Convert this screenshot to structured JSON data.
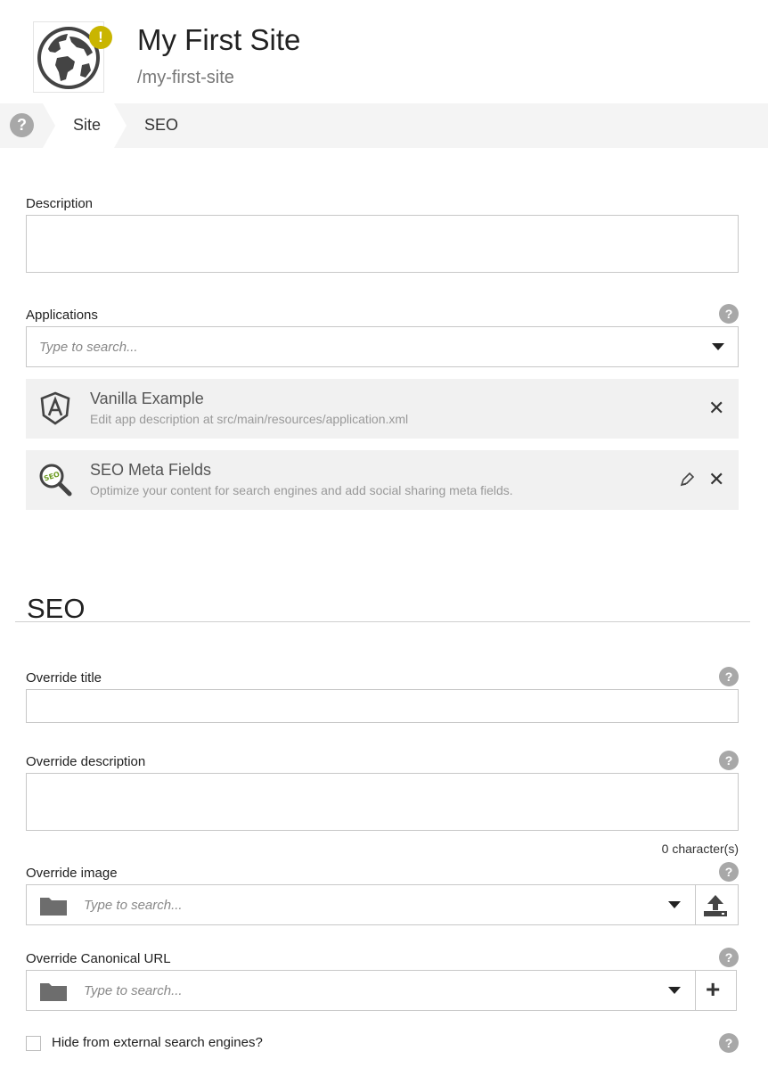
{
  "header": {
    "title": "My First Site",
    "path": "/my-first-site",
    "warning_badge": "!",
    "icon": "globe-icon"
  },
  "tabs": {
    "help": "?",
    "items": [
      {
        "label": "Site",
        "active": true
      },
      {
        "label": "SEO",
        "active": false
      }
    ]
  },
  "site_form": {
    "description_label": "Description",
    "description_value": "",
    "applications_label": "Applications",
    "applications_placeholder": "Type to search...",
    "applications": [
      {
        "name": "Vanilla Example",
        "description": "Edit app description at src/main/resources/application.xml",
        "icon": "app-shield-icon",
        "editable": false
      },
      {
        "name": "SEO Meta Fields",
        "description": "Optimize your content for search engines and add social sharing meta fields.",
        "icon": "seo-magnifier-icon",
        "editable": true
      }
    ]
  },
  "seo_form": {
    "section_title": "SEO",
    "override_title_label": "Override title",
    "override_title_value": "",
    "override_description_label": "Override description",
    "override_description_value": "",
    "character_count": "0 character(s)",
    "override_image_label": "Override image",
    "override_image_placeholder": "Type to search...",
    "override_canonical_label": "Override Canonical URL",
    "override_canonical_placeholder": "Type to search...",
    "add_symbol": "+",
    "hide_label": "Hide from external search engines?",
    "hide_checked": false,
    "help": "?"
  },
  "colors": {
    "warning": "#c9b500",
    "tabbar": "#f4f4f4",
    "card": "#f1f1f1",
    "help": "#a8a8a8"
  }
}
